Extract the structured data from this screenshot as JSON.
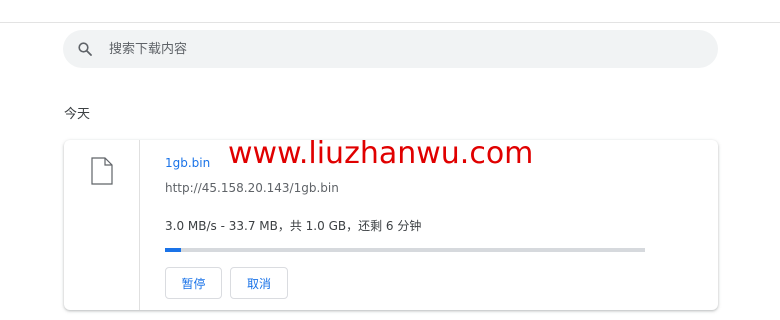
{
  "search": {
    "placeholder": "搜索下载内容",
    "icon": "search-icon"
  },
  "downloads": {
    "date_header": "今天",
    "items": [
      {
        "icon": "file-icon",
        "file_name": "1gb.bin",
        "url": "http://45.158.20.143/1gb.bin",
        "status": "3.0 MB/s - 33.7 MB，共 1.0 GB，还剩 6 分钟",
        "progress_fraction": 0.033,
        "pause_label": "暂停",
        "cancel_label": "取消"
      }
    ]
  },
  "watermark": "www.liuzhanwu.com",
  "colors": {
    "accent": "#1a73e8",
    "watermark": "#e00000",
    "search_bg": "#f1f3f4"
  }
}
